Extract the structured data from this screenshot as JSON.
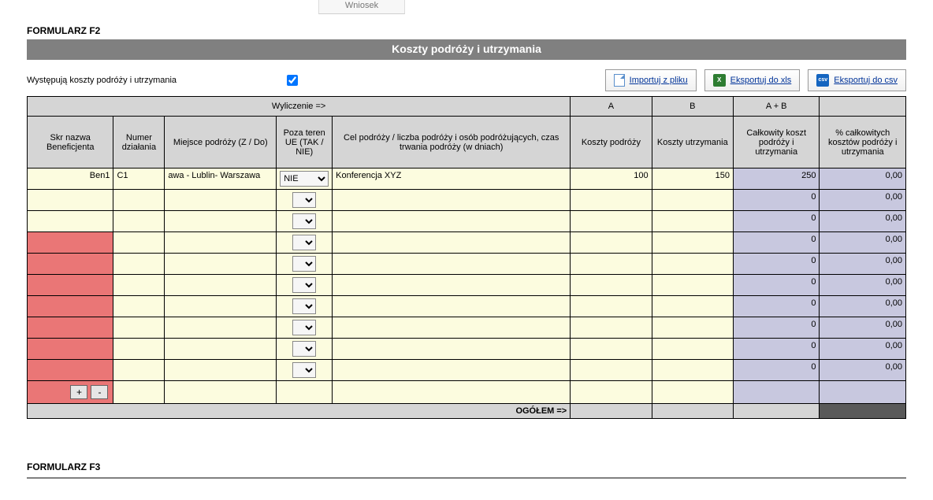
{
  "tab_label": "Wniosek",
  "form_labels": {
    "f2": "FORMULARZ F2",
    "f3": "FORMULARZ F3"
  },
  "chart_data": {
    "type": "table",
    "title": "Koszty podróży i utrzymania",
    "columns": {
      "wyliczenie": "Wyliczenie =>",
      "A": "A",
      "B": "B",
      "AB": "A + B",
      "skr_nazwa": "Skr nazwa Beneficjenta",
      "numer_dzialania": "Numer działania",
      "miejsce": "Miejsce podróży (Z / Do)",
      "poza_teren": "Poza teren UE (TAK / NIE)",
      "cel": "Cel podróży / liczba podróży i osób podróżujących, czas trwania podróży (w dniach)",
      "koszty_podrozy": "Koszty podróży",
      "koszty_utrzymania": "Koszty utrzymania",
      "calkowity": "Całkowity koszt podróży i utrzymania",
      "procent": "% całkowitych kosztów podróży i utrzymania"
    },
    "rows": [
      {
        "skr": "Ben1",
        "numer": "C1",
        "miejsce": "awa - Lublin- Warszawa",
        "poza": "NIE",
        "cel": "Konferencja XYZ",
        "a": "100",
        "b": "150",
        "ab": "250",
        "pct": "0,00",
        "red": false
      },
      {
        "skr": "",
        "numer": "",
        "miejsce": "",
        "poza": "",
        "cel": "",
        "a": "",
        "b": "",
        "ab": "0",
        "pct": "0,00",
        "red": false
      },
      {
        "skr": "",
        "numer": "",
        "miejsce": "",
        "poza": "",
        "cel": "",
        "a": "",
        "b": "",
        "ab": "0",
        "pct": "0,00",
        "red": false
      },
      {
        "skr": "",
        "numer": "",
        "miejsce": "",
        "poza": "",
        "cel": "",
        "a": "",
        "b": "",
        "ab": "0",
        "pct": "0,00",
        "red": true
      },
      {
        "skr": "",
        "numer": "",
        "miejsce": "",
        "poza": "",
        "cel": "",
        "a": "",
        "b": "",
        "ab": "0",
        "pct": "0,00",
        "red": true
      },
      {
        "skr": "",
        "numer": "",
        "miejsce": "",
        "poza": "",
        "cel": "",
        "a": "",
        "b": "",
        "ab": "0",
        "pct": "0,00",
        "red": true
      },
      {
        "skr": "",
        "numer": "",
        "miejsce": "",
        "poza": "",
        "cel": "",
        "a": "",
        "b": "",
        "ab": "0",
        "pct": "0,00",
        "red": true
      },
      {
        "skr": "",
        "numer": "",
        "miejsce": "",
        "poza": "",
        "cel": "",
        "a": "",
        "b": "",
        "ab": "0",
        "pct": "0,00",
        "red": true
      },
      {
        "skr": "",
        "numer": "",
        "miejsce": "",
        "poza": "",
        "cel": "",
        "a": "",
        "b": "",
        "ab": "0",
        "pct": "0,00",
        "red": true
      },
      {
        "skr": "",
        "numer": "",
        "miejsce": "",
        "poza": "",
        "cel": "",
        "a": "",
        "b": "",
        "ab": "0",
        "pct": "0,00",
        "red": true
      }
    ],
    "footer": {
      "ogolem_label": "OGÓŁEM =>",
      "a": "",
      "b": "",
      "ab": "",
      "pct": ""
    }
  },
  "toolbar": {
    "present_costs_label": "Występują koszty podróży i utrzymania",
    "import_label": "Importuj z pliku",
    "export_xls_label": "Eksportuj do xls",
    "export_csv_label": "Eksportuj do csv"
  },
  "buttons": {
    "add": "+",
    "remove": "-"
  }
}
